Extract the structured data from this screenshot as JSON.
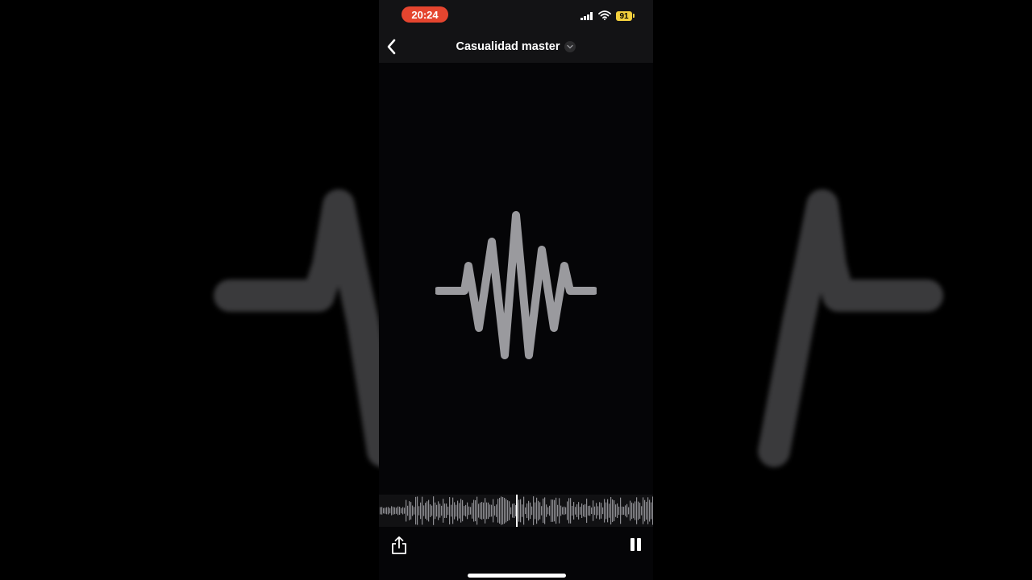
{
  "status_bar": {
    "time": "20:24",
    "battery_level": "91",
    "signal_icon": "cellular-signal-icon",
    "wifi_icon": "wifi-icon"
  },
  "nav": {
    "back_icon": "chevron-left-icon",
    "title": "Casualidad master",
    "title_menu_icon": "chevron-down-icon"
  },
  "player": {
    "artwork_icon": "audio-waveform-icon",
    "share_icon": "share-icon",
    "pause_icon": "pause-icon"
  },
  "colors": {
    "time_pill": "#e5452f",
    "battery": "#f2cf3d",
    "waveform": "#9a9a9e",
    "background": "#050507"
  }
}
